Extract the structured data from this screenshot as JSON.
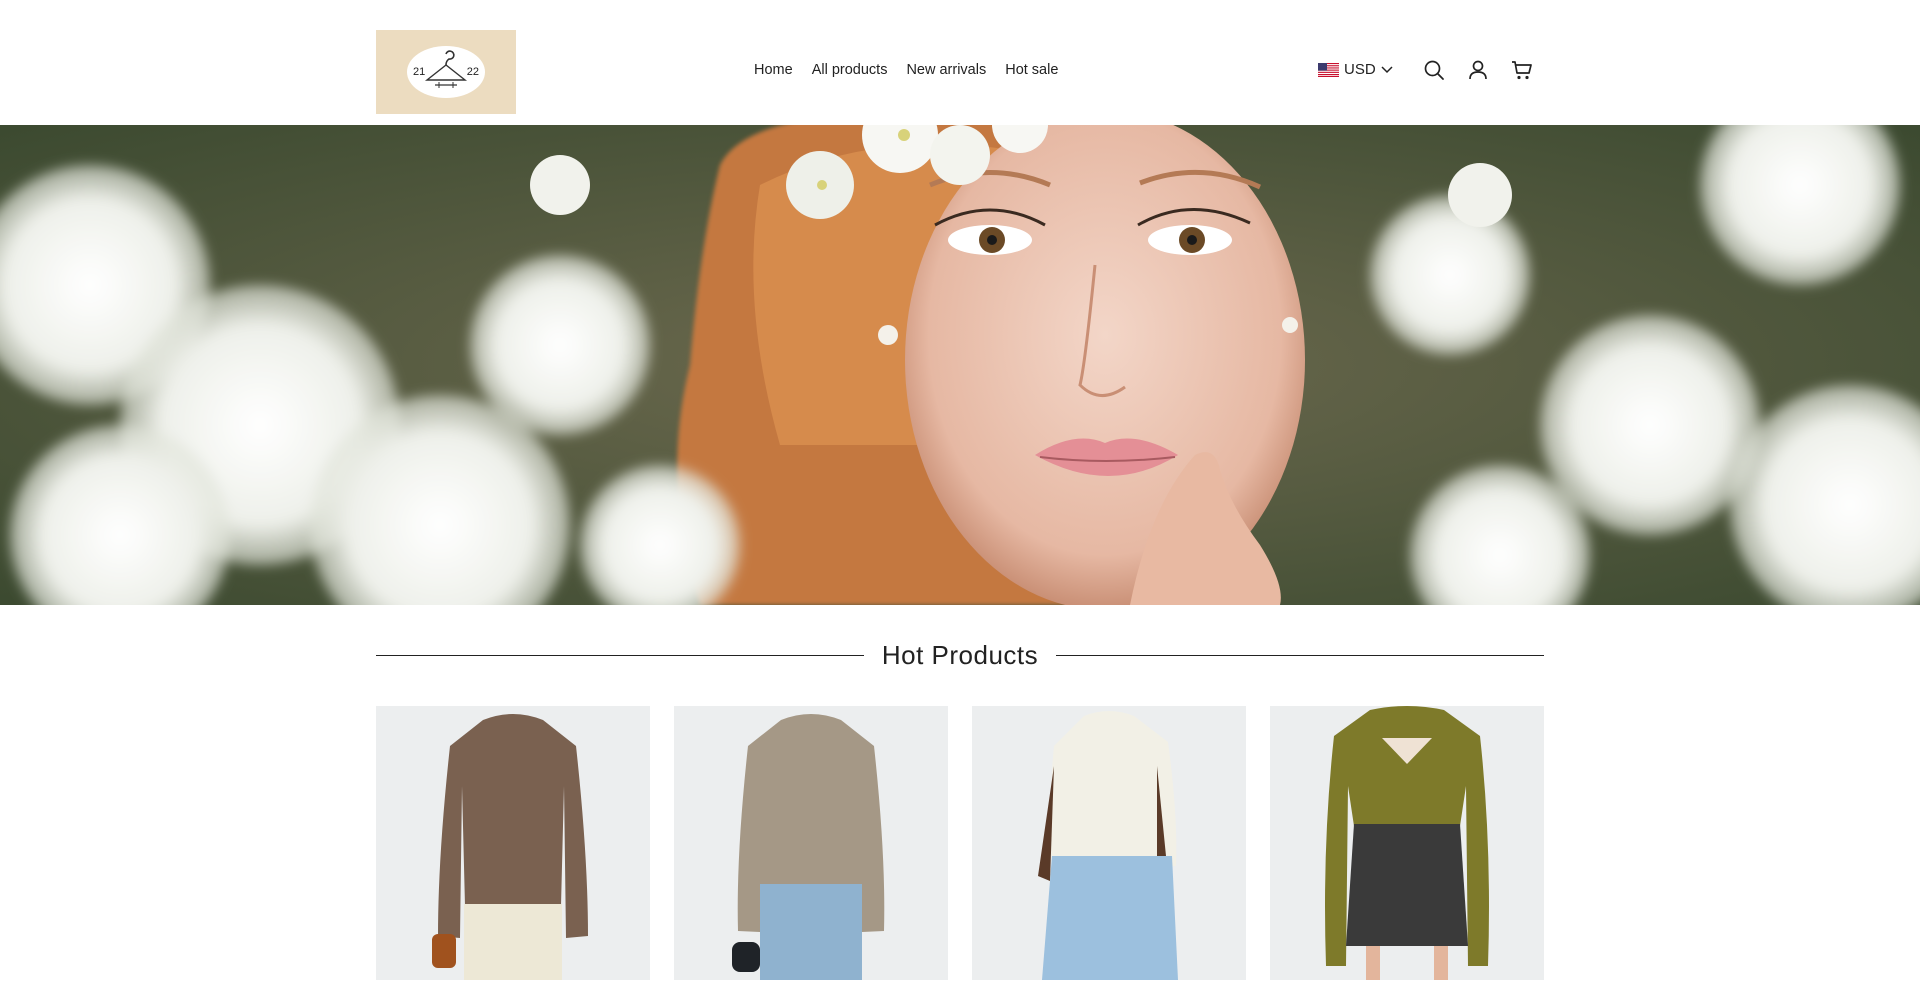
{
  "header": {
    "logo": {
      "left_text": "21",
      "right_text": "22",
      "bg": "#ecdcc0"
    },
    "nav": [
      "Home",
      "All products",
      "New arrivals",
      "Hot sale"
    ],
    "currency": {
      "code": "USD",
      "flag": "us-flag-icon"
    },
    "icons": [
      "search-icon",
      "user-icon",
      "cart-icon"
    ]
  },
  "hero": {
    "image": "woman-with-white-blossoms"
  },
  "section": {
    "title": "Hot Products"
  },
  "products": [
    {
      "image": "brown-ribbed-sweater",
      "color": "#7a6150"
    },
    {
      "image": "beige-ribbed-sweater",
      "color": "#a59886"
    },
    {
      "image": "cream-turtleneck-sweater",
      "color": "#f2f0e6"
    },
    {
      "image": "olive-cutout-knit-top",
      "color": "#7e7a2a"
    }
  ],
  "colors": {
    "text": "#222222",
    "background": "#ffffff",
    "card_bg": "#eceeef"
  }
}
